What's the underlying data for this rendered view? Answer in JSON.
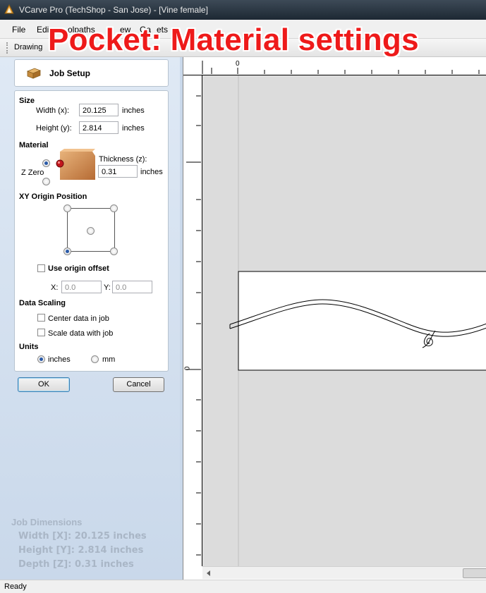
{
  "window": {
    "title": "VCarve Pro (TechShop - San Jose) - [Vine female]"
  },
  "menu": [
    {
      "label": "File"
    },
    {
      "label": "Edi"
    },
    {
      "label": "olpaths"
    },
    {
      "label": "ew"
    },
    {
      "label": "Ga"
    },
    {
      "label": "ets"
    }
  ],
  "tabs": {
    "drawing": "Drawing"
  },
  "caption": "Pocket: Material settings",
  "job_setup": {
    "title": "Job Setup",
    "size": {
      "heading": "Size",
      "width_label": "Width (x):",
      "width_value": "20.125",
      "height_label": "Height (y):",
      "height_value": "2.814",
      "units": "inches"
    },
    "material": {
      "heading": "Material",
      "z_zero_label": "Z Zero",
      "z_zero_selected": "top",
      "thickness_label": "Thickness (z):",
      "thickness_value": "0.31",
      "units": "inches"
    },
    "xy_origin": {
      "heading": "XY Origin Position",
      "selected": "bottom-left",
      "use_offset_label": "Use origin offset",
      "use_offset_checked": false,
      "x_label": "X:",
      "x_value": "0.0",
      "y_label": "Y:",
      "y_value": "0.0"
    },
    "data_scaling": {
      "heading": "Data Scaling",
      "center_label": "Center data in job",
      "center_checked": false,
      "scale_label": "Scale data with job",
      "scale_checked": false
    },
    "units": {
      "heading": "Units",
      "inches_label": "inches",
      "mm_label": "mm",
      "selected": "inches"
    },
    "ok_label": "OK",
    "cancel_label": "Cancel"
  },
  "job_dimensions": {
    "title": "Job Dimensions",
    "width": "Width  [X]: 20.125 inches",
    "height": "Height [Y]: 2.814 inches",
    "depth": "Depth  [Z]: 0.31 inches"
  },
  "rulers": {
    "top_zero": "0",
    "left_zero": "0"
  },
  "status": {
    "text": "Ready"
  },
  "colors": {
    "caption": "#ee1a1a",
    "panel_bg": "#d6e3f1",
    "canvas_bg": "#dcdcdc"
  }
}
